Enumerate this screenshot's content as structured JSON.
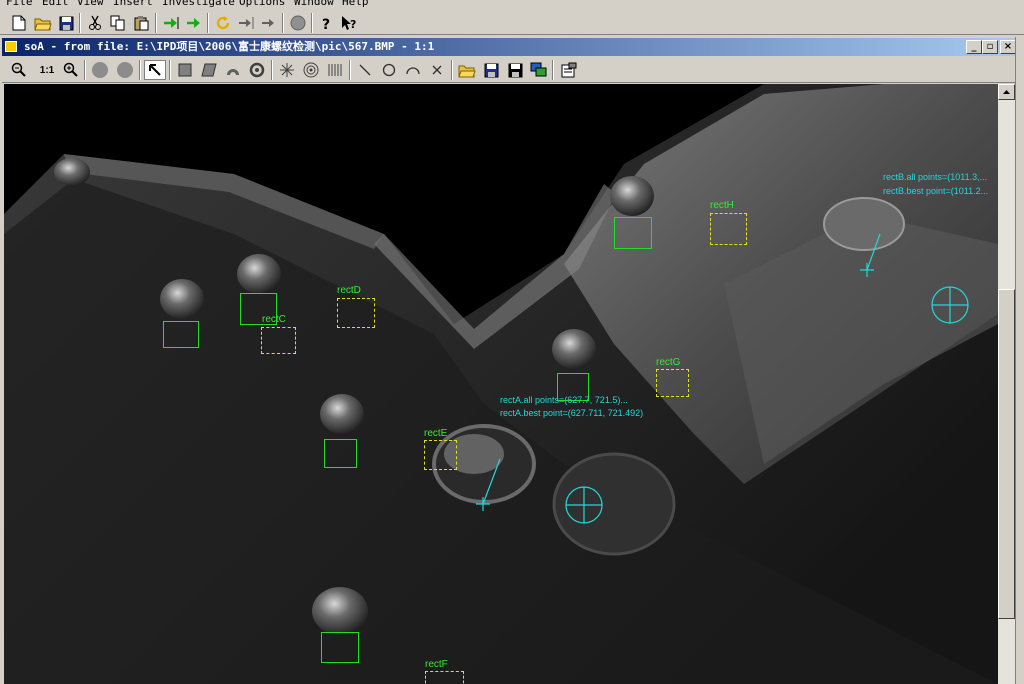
{
  "menu": [
    "File",
    "Edit",
    "View",
    "Insert",
    "Investigate",
    "Options",
    "Window",
    "Help"
  ],
  "window": {
    "title": "soA - from file: E:\\IPD项目\\2006\\富士康螺纹检测\\pic\\567.BMP - 1:1"
  },
  "view_toolbar": {
    "zoom_1to1": "1:1"
  },
  "regions": {
    "rectC": "rectC",
    "rectD": "rectD",
    "rectE": "rectE",
    "rectF": "rectF",
    "rectG": "rectG",
    "rectH": "rectH"
  },
  "annotations": {
    "rectA_all": "rectA.all points=(627.7, 721.5)...",
    "rectA_best": "rectA.best point=(627.711, 721.492)",
    "rectB_all": "rectB.all points=(1011.3,...",
    "rectB_best": "rectB.best point=(1011.2..."
  },
  "colors": {
    "detect_box": "#22dd22",
    "search_box": "#e0e020",
    "marker": "#22d8d8"
  }
}
